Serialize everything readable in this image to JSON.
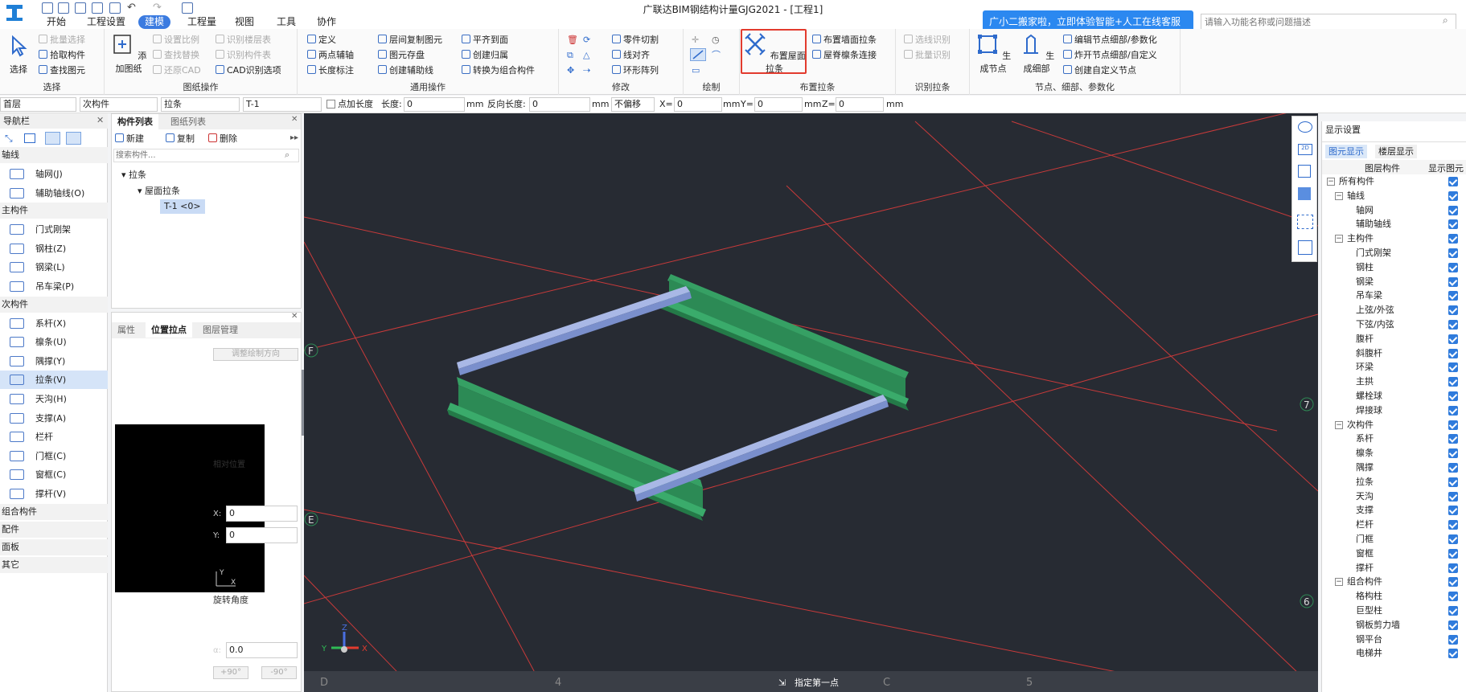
{
  "title": "广联达BIM钢结构计量GJG2021 - [工程1]",
  "menus": [
    "开始",
    "工程设置",
    "建模",
    "工程量",
    "视图",
    "工具",
    "协作"
  ],
  "chat_banner": "广小二搬家啦，立即体验智能+人工在线客服",
  "search_placeholder": "请输入功能名称或问题描述",
  "ribbon": {
    "select": {
      "big": "选择",
      "items": [
        "批量选择",
        "拾取构件",
        "查找图元"
      ],
      "label": "选择"
    },
    "drawing": {
      "big": "添加图纸",
      "items": [
        "设置比例",
        "查找替换",
        "还原CAD",
        "识别楼层表",
        "识别构件表",
        "CAD识别选项"
      ],
      "label": "图纸操作"
    },
    "general": {
      "items": [
        "定义",
        "两点辅轴",
        "长度标注",
        "层间复制图元",
        "图元存盘",
        "创建辅助线",
        "平齐到面",
        "创建归属",
        "转换为组合构件"
      ],
      "label": "通用操作"
    },
    "modify": {
      "items": [
        "零件切割",
        "线对齐",
        "环形阵列"
      ],
      "label": "修改"
    },
    "draw": {
      "label": "绘制"
    },
    "tie": {
      "big": "布置屋面拉条",
      "items": [
        "布置墙面拉条",
        "屋脊檩条连接"
      ],
      "label": "布置拉条"
    },
    "identify": {
      "items": [
        "选线识别",
        "批量识别"
      ],
      "label": "识别拉条"
    },
    "node": {
      "big1": "生成节点",
      "big2": "生成细部",
      "items": [
        "编辑节点细部/参数化",
        "炸开节点细部/自定义",
        "创建自定义节点"
      ],
      "label": "节点、细部、参数化"
    }
  },
  "propbar": {
    "floor": "首层",
    "type": "次构件",
    "member": "拉条",
    "name": "T-1",
    "add_length": "点加长度",
    "len_label": "长度:",
    "len_val": "0",
    "mm1": "mm",
    "rev_label": "反向长度:",
    "rev_val": "0",
    "mm2": "mm",
    "offset": "不偏移",
    "x_label": "X=",
    "x_val": "0",
    "mm3": "mm",
    "y_label": "Y=",
    "y_val": "0",
    "mm4": "mm",
    "z_label": "Z=",
    "z_val": "0",
    "mm5": "mm"
  },
  "nav": {
    "title": "导航栏",
    "categories": [
      {
        "name": "轴线",
        "items": [
          "轴网(J)",
          "辅助轴线(O)"
        ]
      },
      {
        "name": "主构件",
        "items": [
          "门式刚架",
          "钢柱(Z)",
          "钢梁(L)",
          "吊车梁(P)"
        ]
      },
      {
        "name": "次构件",
        "items": [
          "系杆(X)",
          "檩条(U)",
          "隅撑(Y)",
          "拉条(V)",
          "天沟(H)",
          "支撑(A)",
          "栏杆",
          "门框(C)",
          "窗框(C)",
          "撑杆(V)"
        ]
      },
      {
        "name": "组合构件",
        "items": []
      },
      {
        "name": "配件",
        "items": []
      },
      {
        "name": "面板",
        "items": []
      },
      {
        "name": "其它",
        "items": []
      }
    ],
    "selected": "拉条(V)"
  },
  "comp_panel": {
    "tabs": [
      "构件列表",
      "图纸列表"
    ],
    "new": "新建",
    "copy": "复制",
    "delete": "删除",
    "search_placeholder": "搜索构件...",
    "tree": [
      "拉条",
      "屋面拉条",
      "T-1  <0>"
    ]
  },
  "prop_panel": {
    "tabs": [
      "属性",
      "位置拉点",
      "图层管理"
    ],
    "adjust_btn": "调整绘制方向",
    "relative": "相对位置",
    "x_label": "X:",
    "x_val": "0",
    "y_label": "Y:",
    "y_val": "0",
    "rotate": "旋转角度",
    "alpha_label": "α:",
    "alpha_val": "0.0",
    "plus90": "+90°",
    "minus90": "-90°"
  },
  "viewport": {
    "axis_labels_left": [
      "F",
      "E"
    ],
    "axis_labels_right": [
      "7",
      "6"
    ],
    "axis_labels_bottom": [
      "D",
      "4",
      "C",
      "5"
    ],
    "status": "指定第一点",
    "triad": [
      "Z",
      "Y",
      "X"
    ]
  },
  "display": {
    "title": "显示设置",
    "tabs": [
      "图元显示",
      "楼层显示"
    ],
    "col1": "图层构件",
    "col2": "显示图元",
    "rows": [
      {
        "t": "所有构件",
        "lvl": 0,
        "exp": true
      },
      {
        "t": "轴线",
        "lvl": 1,
        "exp": true
      },
      {
        "t": "轴网",
        "lvl": 2
      },
      {
        "t": "辅助轴线",
        "lvl": 2
      },
      {
        "t": "主构件",
        "lvl": 1,
        "exp": true
      },
      {
        "t": "门式刚架",
        "lvl": 2
      },
      {
        "t": "钢柱",
        "lvl": 2
      },
      {
        "t": "钢梁",
        "lvl": 2
      },
      {
        "t": "吊车梁",
        "lvl": 2
      },
      {
        "t": "上弦/外弦",
        "lvl": 2
      },
      {
        "t": "下弦/内弦",
        "lvl": 2
      },
      {
        "t": "腹杆",
        "lvl": 2
      },
      {
        "t": "斜腹杆",
        "lvl": 2
      },
      {
        "t": "环梁",
        "lvl": 2
      },
      {
        "t": "主拱",
        "lvl": 2
      },
      {
        "t": "螺栓球",
        "lvl": 2
      },
      {
        "t": "焊接球",
        "lvl": 2
      },
      {
        "t": "次构件",
        "lvl": 1,
        "exp": true
      },
      {
        "t": "系杆",
        "lvl": 2
      },
      {
        "t": "檩条",
        "lvl": 2
      },
      {
        "t": "隅撑",
        "lvl": 2
      },
      {
        "t": "拉条",
        "lvl": 2
      },
      {
        "t": "天沟",
        "lvl": 2
      },
      {
        "t": "支撑",
        "lvl": 2
      },
      {
        "t": "栏杆",
        "lvl": 2
      },
      {
        "t": "门框",
        "lvl": 2
      },
      {
        "t": "窗框",
        "lvl": 2
      },
      {
        "t": "撑杆",
        "lvl": 2
      },
      {
        "t": "组合构件",
        "lvl": 1,
        "exp": true
      },
      {
        "t": "格构柱",
        "lvl": 2
      },
      {
        "t": "巨型柱",
        "lvl": 2
      },
      {
        "t": "钢板剪力墙",
        "lvl": 2
      },
      {
        "t": "钢平台",
        "lvl": 2
      },
      {
        "t": "电梯井",
        "lvl": 2
      }
    ]
  },
  "colors": {
    "accent": "#3b7be0",
    "highlight": "#e23b2e",
    "beam_green": "#2f8f55",
    "purlin_blue": "#8fa3d9",
    "grid_red": "#c83a3a",
    "viewport_bg": "#272b33"
  }
}
